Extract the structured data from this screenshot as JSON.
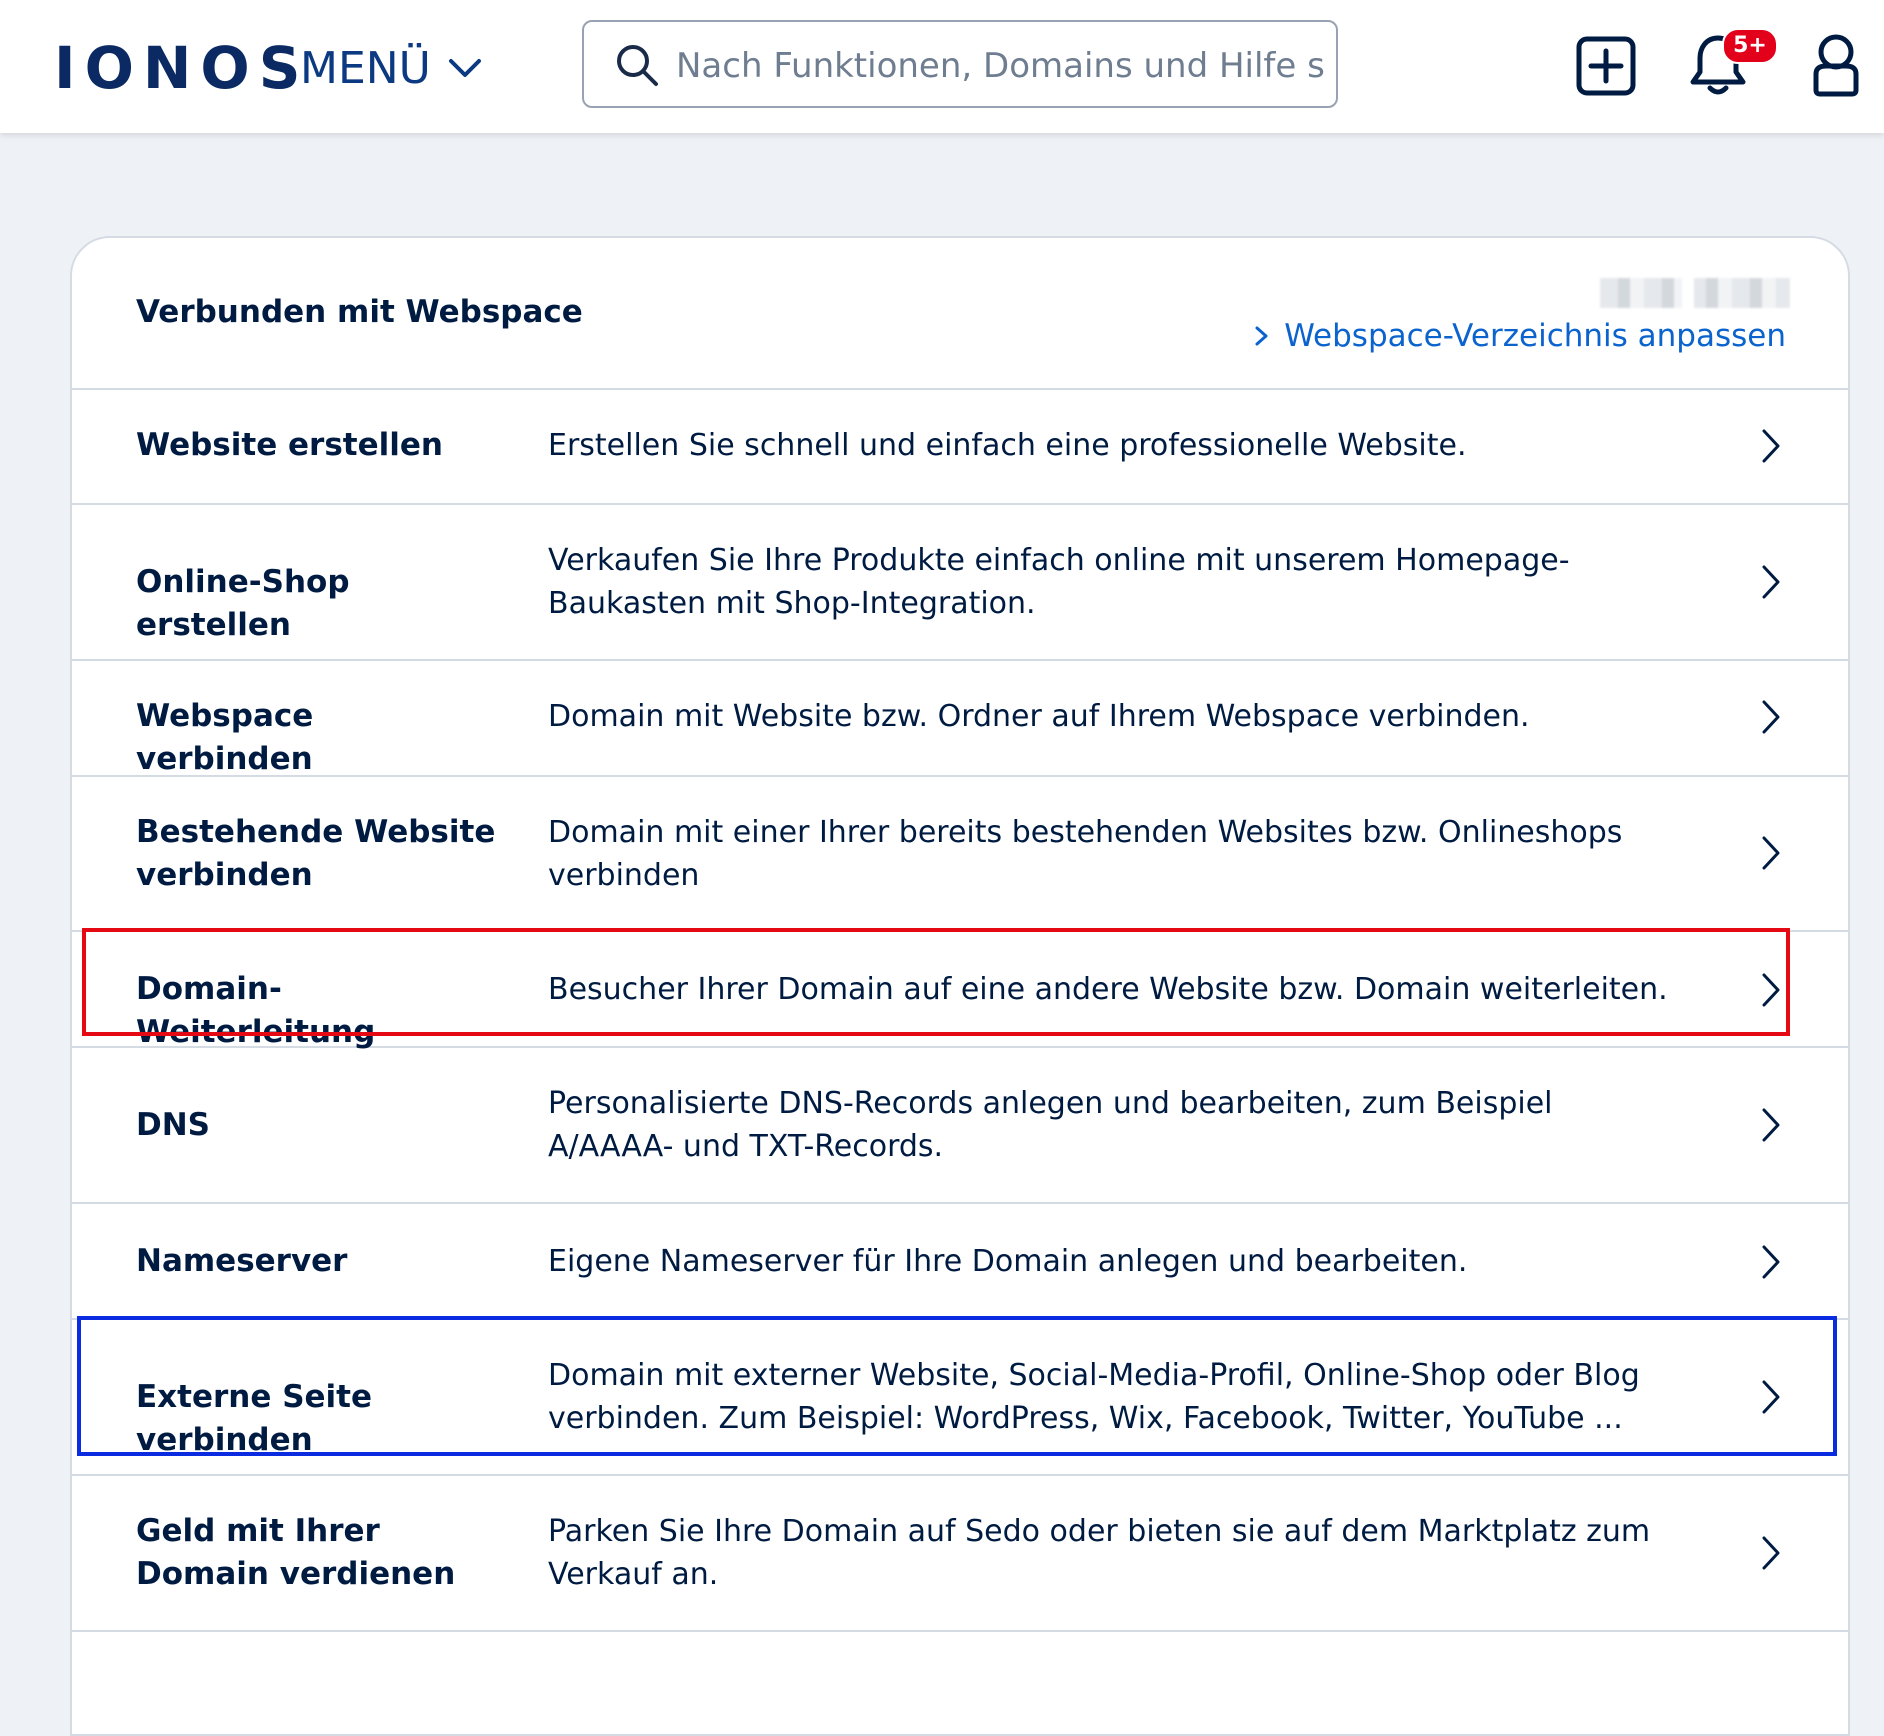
{
  "header": {
    "logo": "IONOS",
    "menu_label": "MENÜ",
    "search_placeholder": "Nach Funktionen, Domains und Hilfe s...",
    "notification_count": "5+"
  },
  "card": {
    "title": "Verbunden mit Webspace",
    "webspace_link": "Webspace-Verzeichnis anpassen",
    "rows": [
      {
        "label": "Website erstellen",
        "desc": "Erstellen Sie schnell und einfach eine professionelle Website."
      },
      {
        "label": "Online-Shop erstellen",
        "desc": "Verkaufen Sie Ihre Produkte einfach online mit unserem Homepage-Baukasten mit Shop-Integration."
      },
      {
        "label": "Webspace verbinden",
        "desc": "Domain mit Website bzw. Ordner auf Ihrem Webspace verbinden."
      },
      {
        "label": "Bestehende Website verbinden",
        "desc": "Domain mit einer Ihrer bereits bestehenden Websites bzw. Onlineshops verbinden"
      },
      {
        "label": "Domain-Weiterleitung",
        "desc": "Besucher Ihrer Domain auf eine andere Website bzw. Domain weiterleiten."
      },
      {
        "label": "DNS",
        "desc": "Personalisierte DNS-Records anlegen und bearbeiten, zum Beispiel A/AAAA- und TXT-Records."
      },
      {
        "label": "Nameserver",
        "desc": "Eigene Nameserver für Ihre Domain anlegen und bearbeiten."
      },
      {
        "label": "Externe Seite verbinden",
        "desc": "Domain mit externer Website, Social-Media-Profil, Online-Shop oder Blog verbinden. Zum Beispiel: WordPress, Wix, Facebook, Twitter, YouTube ..."
      },
      {
        "label": "Geld mit Ihrer Domain verdienen",
        "desc": "Parken Sie Ihre Domain auf Sedo oder bieten sie auf dem Marktplatz zum Verkauf an."
      }
    ]
  },
  "colors": {
    "accent_blue": "#0b63ce",
    "navy": "#001b41",
    "highlight_red": "#e50914",
    "highlight_blue": "#0a2be0",
    "badge_red": "#e2001a"
  },
  "icons": [
    "search-icon",
    "chevron-down-icon",
    "plus-square-icon",
    "bell-icon",
    "user-icon",
    "chevron-right-icon"
  ]
}
